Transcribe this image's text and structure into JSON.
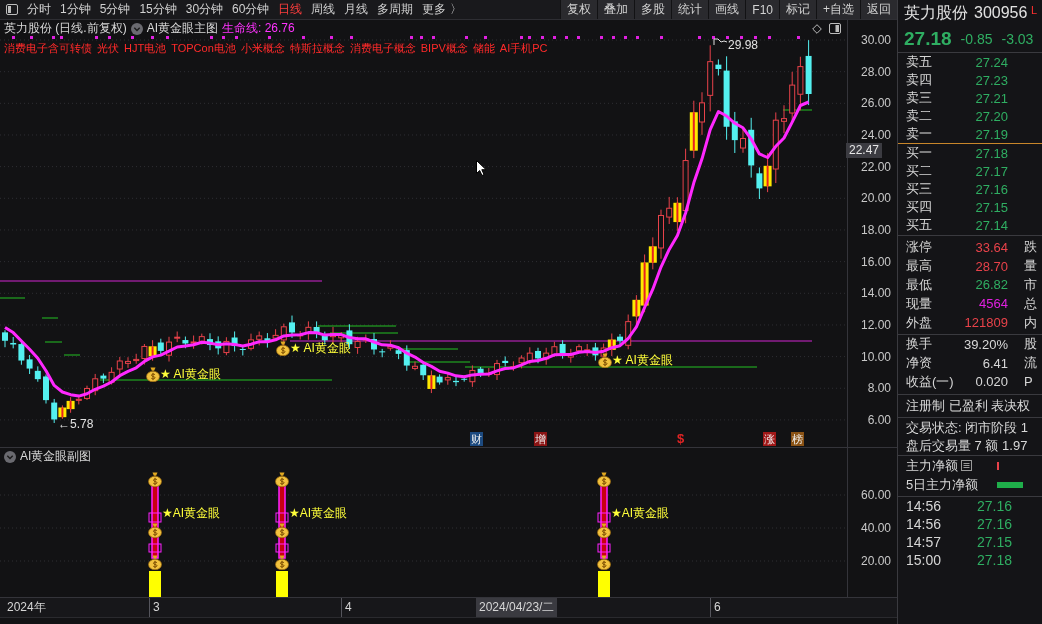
{
  "toolbar": {
    "periods": [
      {
        "label": "分时",
        "selected": false
      },
      {
        "label": "1分钟",
        "selected": false
      },
      {
        "label": "5分钟",
        "selected": false
      },
      {
        "label": "15分钟",
        "selected": false
      },
      {
        "label": "30分钟",
        "selected": false
      },
      {
        "label": "60分钟",
        "selected": false
      },
      {
        "label": "日线",
        "selected": true
      },
      {
        "label": "周线",
        "selected": false
      },
      {
        "label": "月线",
        "selected": false
      },
      {
        "label": "多周期",
        "selected": false
      },
      {
        "label": "更多 〉",
        "selected": false
      }
    ],
    "buttons": [
      "复权",
      "叠加",
      "多股",
      "统计",
      "画线",
      "F10",
      "标记",
      "+自选",
      "返回"
    ]
  },
  "main_chart": {
    "title": "英力股份 (日线.前复权)",
    "indicator": "AI黄金眼主图",
    "life_line": "生命线: 26.76",
    "concepts": [
      "消费电子含可转债",
      "光伏",
      "HJT电池",
      "TOPCon电池",
      "小米概念",
      "特斯拉概念",
      "消费电子概念",
      "BIPV概念",
      "储能",
      "AI手机PC"
    ],
    "price_axis": [
      "30.00",
      "28.00",
      "26.00",
      "24.00",
      "22.00",
      "20.00",
      "18.00",
      "16.00",
      "14.00",
      "12.00",
      "10.00",
      "8.00",
      "6.00"
    ],
    "crosshair_price": "22.47",
    "high_label": "29.98",
    "low_label": "←5.78",
    "signals": [
      "★ AI黄金眼",
      "★ AI黄金眼",
      "★ AI黄金眼"
    ],
    "events": [
      {
        "label": "财",
        "kind": "badge",
        "color": "#1c4a80"
      },
      {
        "label": "增",
        "kind": "badge",
        "color": "#8a1414"
      },
      {
        "label": "$",
        "kind": "text",
        "color": "#e02424"
      },
      {
        "label": "涨",
        "kind": "badge",
        "color": "#a01818"
      },
      {
        "label": "榜",
        "kind": "badge",
        "color": "#8a5214"
      }
    ]
  },
  "sub_chart": {
    "title": "AI黄金眼副图",
    "axis": [
      "60.00",
      "40.00",
      "20.00"
    ],
    "signals": [
      "★AI黄金眼",
      "★AI黄金眼",
      "★AI黄金眼"
    ]
  },
  "time_axis": [
    {
      "label": "2024年",
      "kind": "tick"
    },
    {
      "label": "3",
      "kind": "tick"
    },
    {
      "label": "4",
      "kind": "tick"
    },
    {
      "label": "2024/04/23/二",
      "kind": "cursor"
    },
    {
      "label": "6",
      "kind": "tick"
    }
  ],
  "quote": {
    "name": "英力股份",
    "code": "300956",
    "flag": "L",
    "price": "27.18",
    "change": "-0.85",
    "change_pct": "-3.03",
    "asks": [
      {
        "label": "卖五",
        "price": "27.24"
      },
      {
        "label": "卖四",
        "price": "27.23"
      },
      {
        "label": "卖三",
        "price": "27.21"
      },
      {
        "label": "卖二",
        "price": "27.20"
      },
      {
        "label": "卖一",
        "price": "27.19"
      }
    ],
    "bids": [
      {
        "label": "买一",
        "price": "27.18"
      },
      {
        "label": "买二",
        "price": "27.17"
      },
      {
        "label": "买三",
        "price": "27.16"
      },
      {
        "label": "买四",
        "price": "27.15"
      },
      {
        "label": "买五",
        "price": "27.14"
      }
    ],
    "stats": [
      {
        "label": "涨停",
        "value": "33.64",
        "color": "#e8424a",
        "edge": "跌"
      },
      {
        "label": "最高",
        "value": "28.70",
        "color": "#e8424a",
        "edge": "量"
      },
      {
        "label": "最低",
        "value": "26.82",
        "color": "#2fae62",
        "edge": "市"
      },
      {
        "label": "现量",
        "value": "4564",
        "color": "#e020e0",
        "edge": "总"
      },
      {
        "label": "外盘",
        "value": "121809",
        "color": "#e8424a",
        "edge": "内"
      }
    ],
    "ratios": [
      {
        "label": "换手",
        "value": "39.20%",
        "edge": "股"
      },
      {
        "label": "净资",
        "value": "6.41",
        "edge": "流"
      },
      {
        "label": "收益(一)",
        "value": "0.020",
        "edge": "P"
      }
    ],
    "tags": "注册制 已盈利 表决权",
    "status": [
      "交易状态: 闭市阶段 1",
      "盘后交易量 7 额 1.97"
    ],
    "fund_flow": [
      {
        "label": "主力净额",
        "kind": "tick"
      },
      {
        "label": "5日主力净额",
        "kind": "bar"
      }
    ],
    "trades": [
      {
        "time": "14:56",
        "price": "27.16"
      },
      {
        "time": "14:56",
        "price": "27.16"
      },
      {
        "time": "14:57",
        "price": "27.15"
      },
      {
        "time": "15:00",
        "price": "27.18"
      }
    ]
  }
}
